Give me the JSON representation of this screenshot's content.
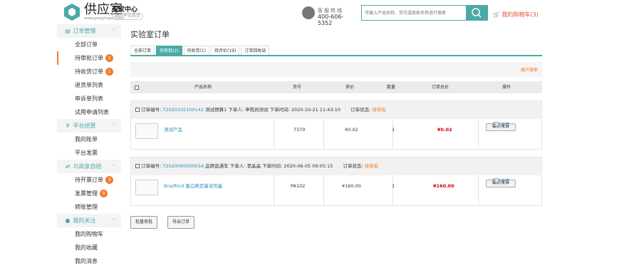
{
  "header": {
    "logo_name": "供应室",
    "logo_site": "www.gongyingshi.com",
    "center_title": "买家中心",
    "center_back": "返回平台首页",
    "hotline_label": "客服热线",
    "hotline_number": "400-606-5352",
    "search_placeholder": "可输入产品名称、货号或商家名称进行搜索",
    "cart_label": "我的购物车(3)"
  },
  "sidebar": {
    "groups": [
      {
        "label": "订单管理",
        "icon": "order-icon",
        "items": [
          {
            "label": "全部订单"
          },
          {
            "label": "待审批订单",
            "badge": "2",
            "active": true
          },
          {
            "label": "待收货订单",
            "badge": "1"
          },
          {
            "label": "退货单列表"
          },
          {
            "label": "申诉单列表"
          },
          {
            "label": "试用申请列表"
          }
        ]
      },
      {
        "label": "平台结算",
        "icon": "yen-icon",
        "items": [
          {
            "label": "我的账单"
          },
          {
            "label": "平台发票"
          }
        ]
      },
      {
        "label": "与商家自结",
        "icon": "settle-icon",
        "items": [
          {
            "label": "待开票订单",
            "badge": "3"
          },
          {
            "label": "发票管理",
            "badge": "9"
          },
          {
            "label": "转账管理"
          }
        ]
      },
      {
        "label": "我的关注",
        "icon": "user-icon",
        "items": [
          {
            "label": "我的购物车"
          },
          {
            "label": "我的收藏"
          },
          {
            "label": "我的消息"
          }
        ]
      }
    ]
  },
  "main": {
    "title": "实验室订单",
    "tabs": [
      "全部订单",
      "待审批(2)",
      "待收货(1)",
      "待评价(19)",
      "订单回收站"
    ],
    "expand_search": "展开搜索",
    "columns": {
      "product": "产品名称",
      "sku": "货号",
      "price": "单价",
      "qty": "数量",
      "total": "订单总价",
      "action": "操作"
    },
    "orders": [
      {
        "no_label": "订单编号:",
        "no": "T2020102100142",
        "info": "测试预算1 下单人: 申购员测试 下单时间: 2020-10-21 11:43:10",
        "status_label": "订单状态:",
        "status": "待审批",
        "product": "测试产品",
        "sku": "7370",
        "price": "¥0.02",
        "qty": "1",
        "total": "¥0.02",
        "confirm": "确认/批准",
        "detail": "订单详情"
      },
      {
        "no_label": "订单编号:",
        "no": "T2020060500016",
        "info": "品牌直通车 下单人: 李晶晶 下单时间: 2020-06-05 09:05:15",
        "status_label": "订单状态:",
        "status": "待审批",
        "product": "Bradford 蛋白质定量试剂盒",
        "sku": "PA102",
        "price": "¥160.00",
        "qty": "1",
        "total": "¥160.00",
        "confirm": "确认/批准",
        "detail": "订单详情"
      }
    ],
    "batch_approve": "批量审批",
    "export": "导出订单"
  },
  "colors": {
    "accent": "#4aaaa5",
    "orange": "#f07e2a",
    "price_red": "#cc0000"
  }
}
